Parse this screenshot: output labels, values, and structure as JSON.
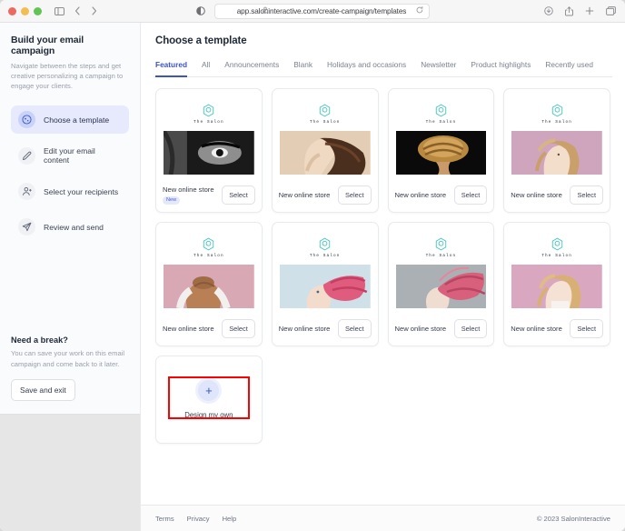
{
  "browser": {
    "url": "app.saloninteractive.com/create-campaign/templates",
    "traffic_lights": [
      "close",
      "minimize",
      "maximize"
    ],
    "left_icons": [
      "sidebar-icon",
      "back-icon",
      "forward-icon"
    ],
    "right_icons": [
      "downloads-icon",
      "share-icon",
      "new-tab-icon",
      "tab-overview-icon"
    ],
    "toolbar_icons": [
      "reader-view-icon",
      "lock-icon",
      "reload-icon"
    ]
  },
  "sidebar": {
    "title": "Build your email campaign",
    "subtitle": "Navigate between the steps and get creative personalizing a campaign to engage your clients.",
    "steps": [
      {
        "label": "Choose a template",
        "icon": "palette-icon",
        "active": true
      },
      {
        "label": "Edit your email content",
        "icon": "pencil-icon",
        "active": false
      },
      {
        "label": "Select your recipients",
        "icon": "person-icon",
        "active": false
      },
      {
        "label": "Review and send",
        "icon": "paper-plane-icon",
        "active": false
      }
    ],
    "break": {
      "title": "Need a break?",
      "text": "You can save your work on this email campaign and come back to it later.",
      "button": "Save and exit"
    }
  },
  "main": {
    "page_title": "Choose a template",
    "tabs": [
      {
        "label": "Featured",
        "active": true
      },
      {
        "label": "All",
        "active": false
      },
      {
        "label": "Announcements",
        "active": false
      },
      {
        "label": "Blank",
        "active": false
      },
      {
        "label": "Holidays and occasions",
        "active": false
      },
      {
        "label": "Newsletter",
        "active": false
      },
      {
        "label": "Product highlights",
        "active": false
      },
      {
        "label": "Recently used",
        "active": false
      }
    ],
    "logo_text": "The Salon",
    "select_label": "Select",
    "cards": [
      {
        "name": "New online store",
        "badge": "New",
        "photo": "bw-portrait-eye"
      },
      {
        "name": "New online store",
        "badge": "",
        "photo": "curly-hair-tan"
      },
      {
        "name": "New online store",
        "badge": "",
        "photo": "blonde-dreads-dark"
      },
      {
        "name": "New online store",
        "badge": "",
        "photo": "wavy-hair-pink"
      },
      {
        "name": "New online store",
        "badge": "",
        "photo": "back-hair-pink"
      },
      {
        "name": "New online store",
        "badge": "",
        "photo": "pink-hair-blue"
      },
      {
        "name": "New online store",
        "badge": "",
        "photo": "pink-hair-gray"
      },
      {
        "name": "New online store",
        "badge": "",
        "photo": "blonde-curls-pink"
      }
    ],
    "design_card": {
      "label": "Design my own",
      "icon": "plus-icon"
    }
  },
  "footer": {
    "links": [
      "Terms",
      "Privacy",
      "Help"
    ],
    "copyright": "© 2023 SalonInteractive"
  },
  "colors": {
    "accent": "#3b55c8",
    "accent_soft": "#e7eafc",
    "logo_teal": "#3ec6c0",
    "highlight_red": "#ff0000"
  }
}
